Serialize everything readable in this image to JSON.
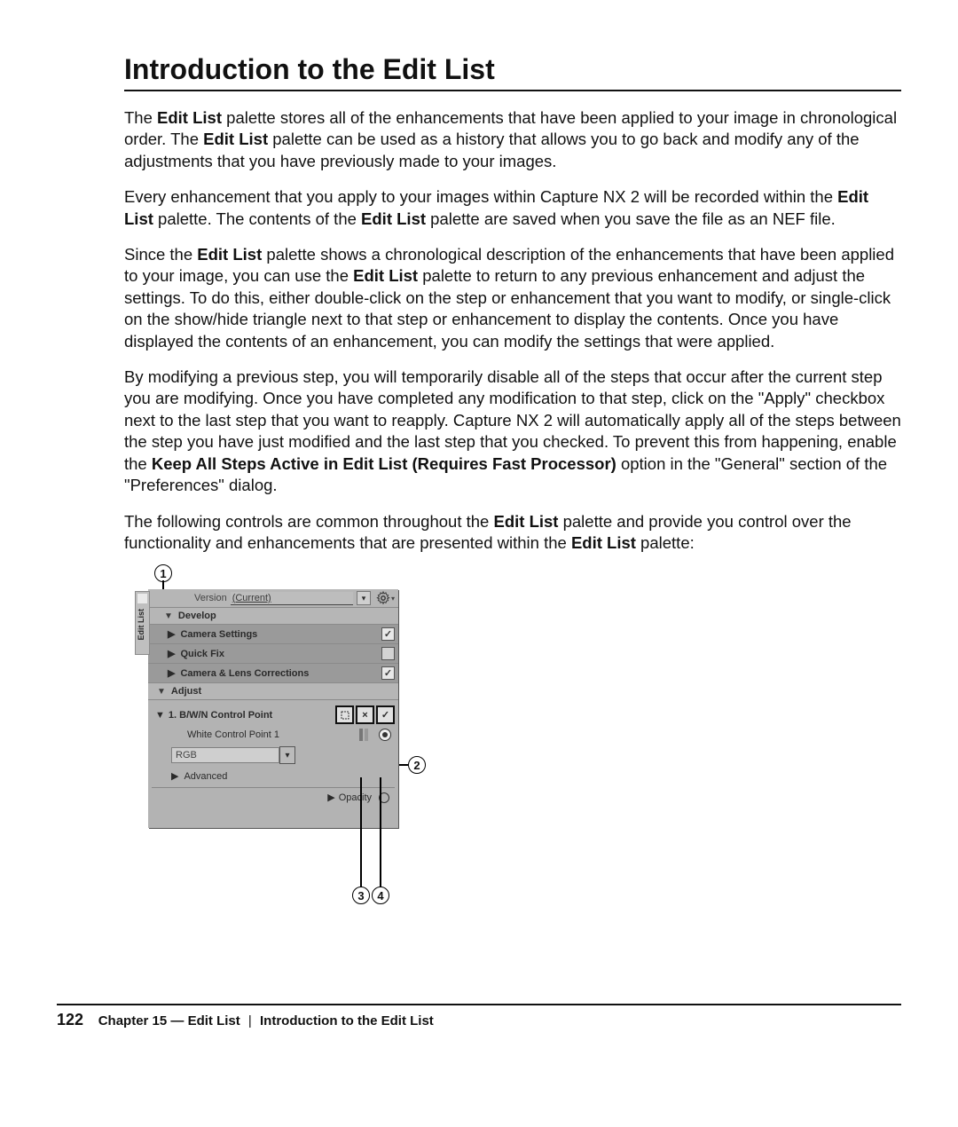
{
  "title": "Introduction to the Edit List",
  "para1": {
    "t1": "The ",
    "b1": "Edit List",
    "t2": " palette stores all of the enhancements that have been applied to your image in chronological order. The ",
    "b2": "Edit List",
    "t3": " palette can be used as a history that allows you to go back and modify any of the adjustments that you have previously made to your images."
  },
  "para2": {
    "t1": "Every enhancement that you apply to your images within Capture NX 2 will be recorded within the ",
    "b1": "Edit List",
    "t2": " palette. The contents of the ",
    "b2": "Edit List",
    "t3": " palette are saved when you save the file as an NEF file."
  },
  "para3": {
    "t1": "Since the ",
    "b1": "Edit List",
    "t2": " palette shows a chronological description of the enhancements that have been applied to your image, you can use the ",
    "b2": "Edit List",
    "t3": " palette to return to any previous enhancement and adjust the settings. To do this, either double-click on the step or enhancement that you want to modify, or single-click on the show/hide triangle next to that step or enhancement to display the contents. Once you have displayed the contents of an enhancement, you can modify the settings that were applied."
  },
  "para4": {
    "t1": "By modifying a previous step, you will temporarily disable all of the steps that occur after the current step you are modifying. Once you have completed any modification to that step, click on the \"Apply\" checkbox next to the last step that you want to reapply. Capture NX 2 will automatically apply all of the steps between the step you have just modified and the last step that you checked. To prevent this from happening, enable the ",
    "b1": "Keep All Steps Active in Edit List (Requires Fast Processor)",
    "t2": " option in the \"General\" section of the \"Preferences\" dialog."
  },
  "para5": {
    "t1": "The following controls are common throughout the ",
    "b1": "Edit List",
    "t2": " palette and provide you control over the functionality and enhancements that are presented within the ",
    "b2": "Edit List",
    "t3": " palette:"
  },
  "callouts": {
    "c1": "1",
    "c2": "2",
    "c3": "3",
    "c4": "4"
  },
  "palette": {
    "tab_label": "Edit List",
    "version_label": "Version",
    "version_value": "(Current)",
    "develop": "Develop",
    "camera_settings": "Camera Settings",
    "quick_fix": "Quick Fix",
    "camera_lens": "Camera & Lens Corrections",
    "adjust": "Adjust",
    "bwn": "1. B/W/N Control Point",
    "wcp": "White Control Point 1",
    "rgb": "RGB",
    "advanced": "Advanced",
    "opacity": "Opacity",
    "check_glyph": "✓",
    "x_glyph": "×"
  },
  "footer": {
    "page_number": "122",
    "chapter": "Chapter 15 — Edit List",
    "section": "Introduction to the Edit List"
  }
}
